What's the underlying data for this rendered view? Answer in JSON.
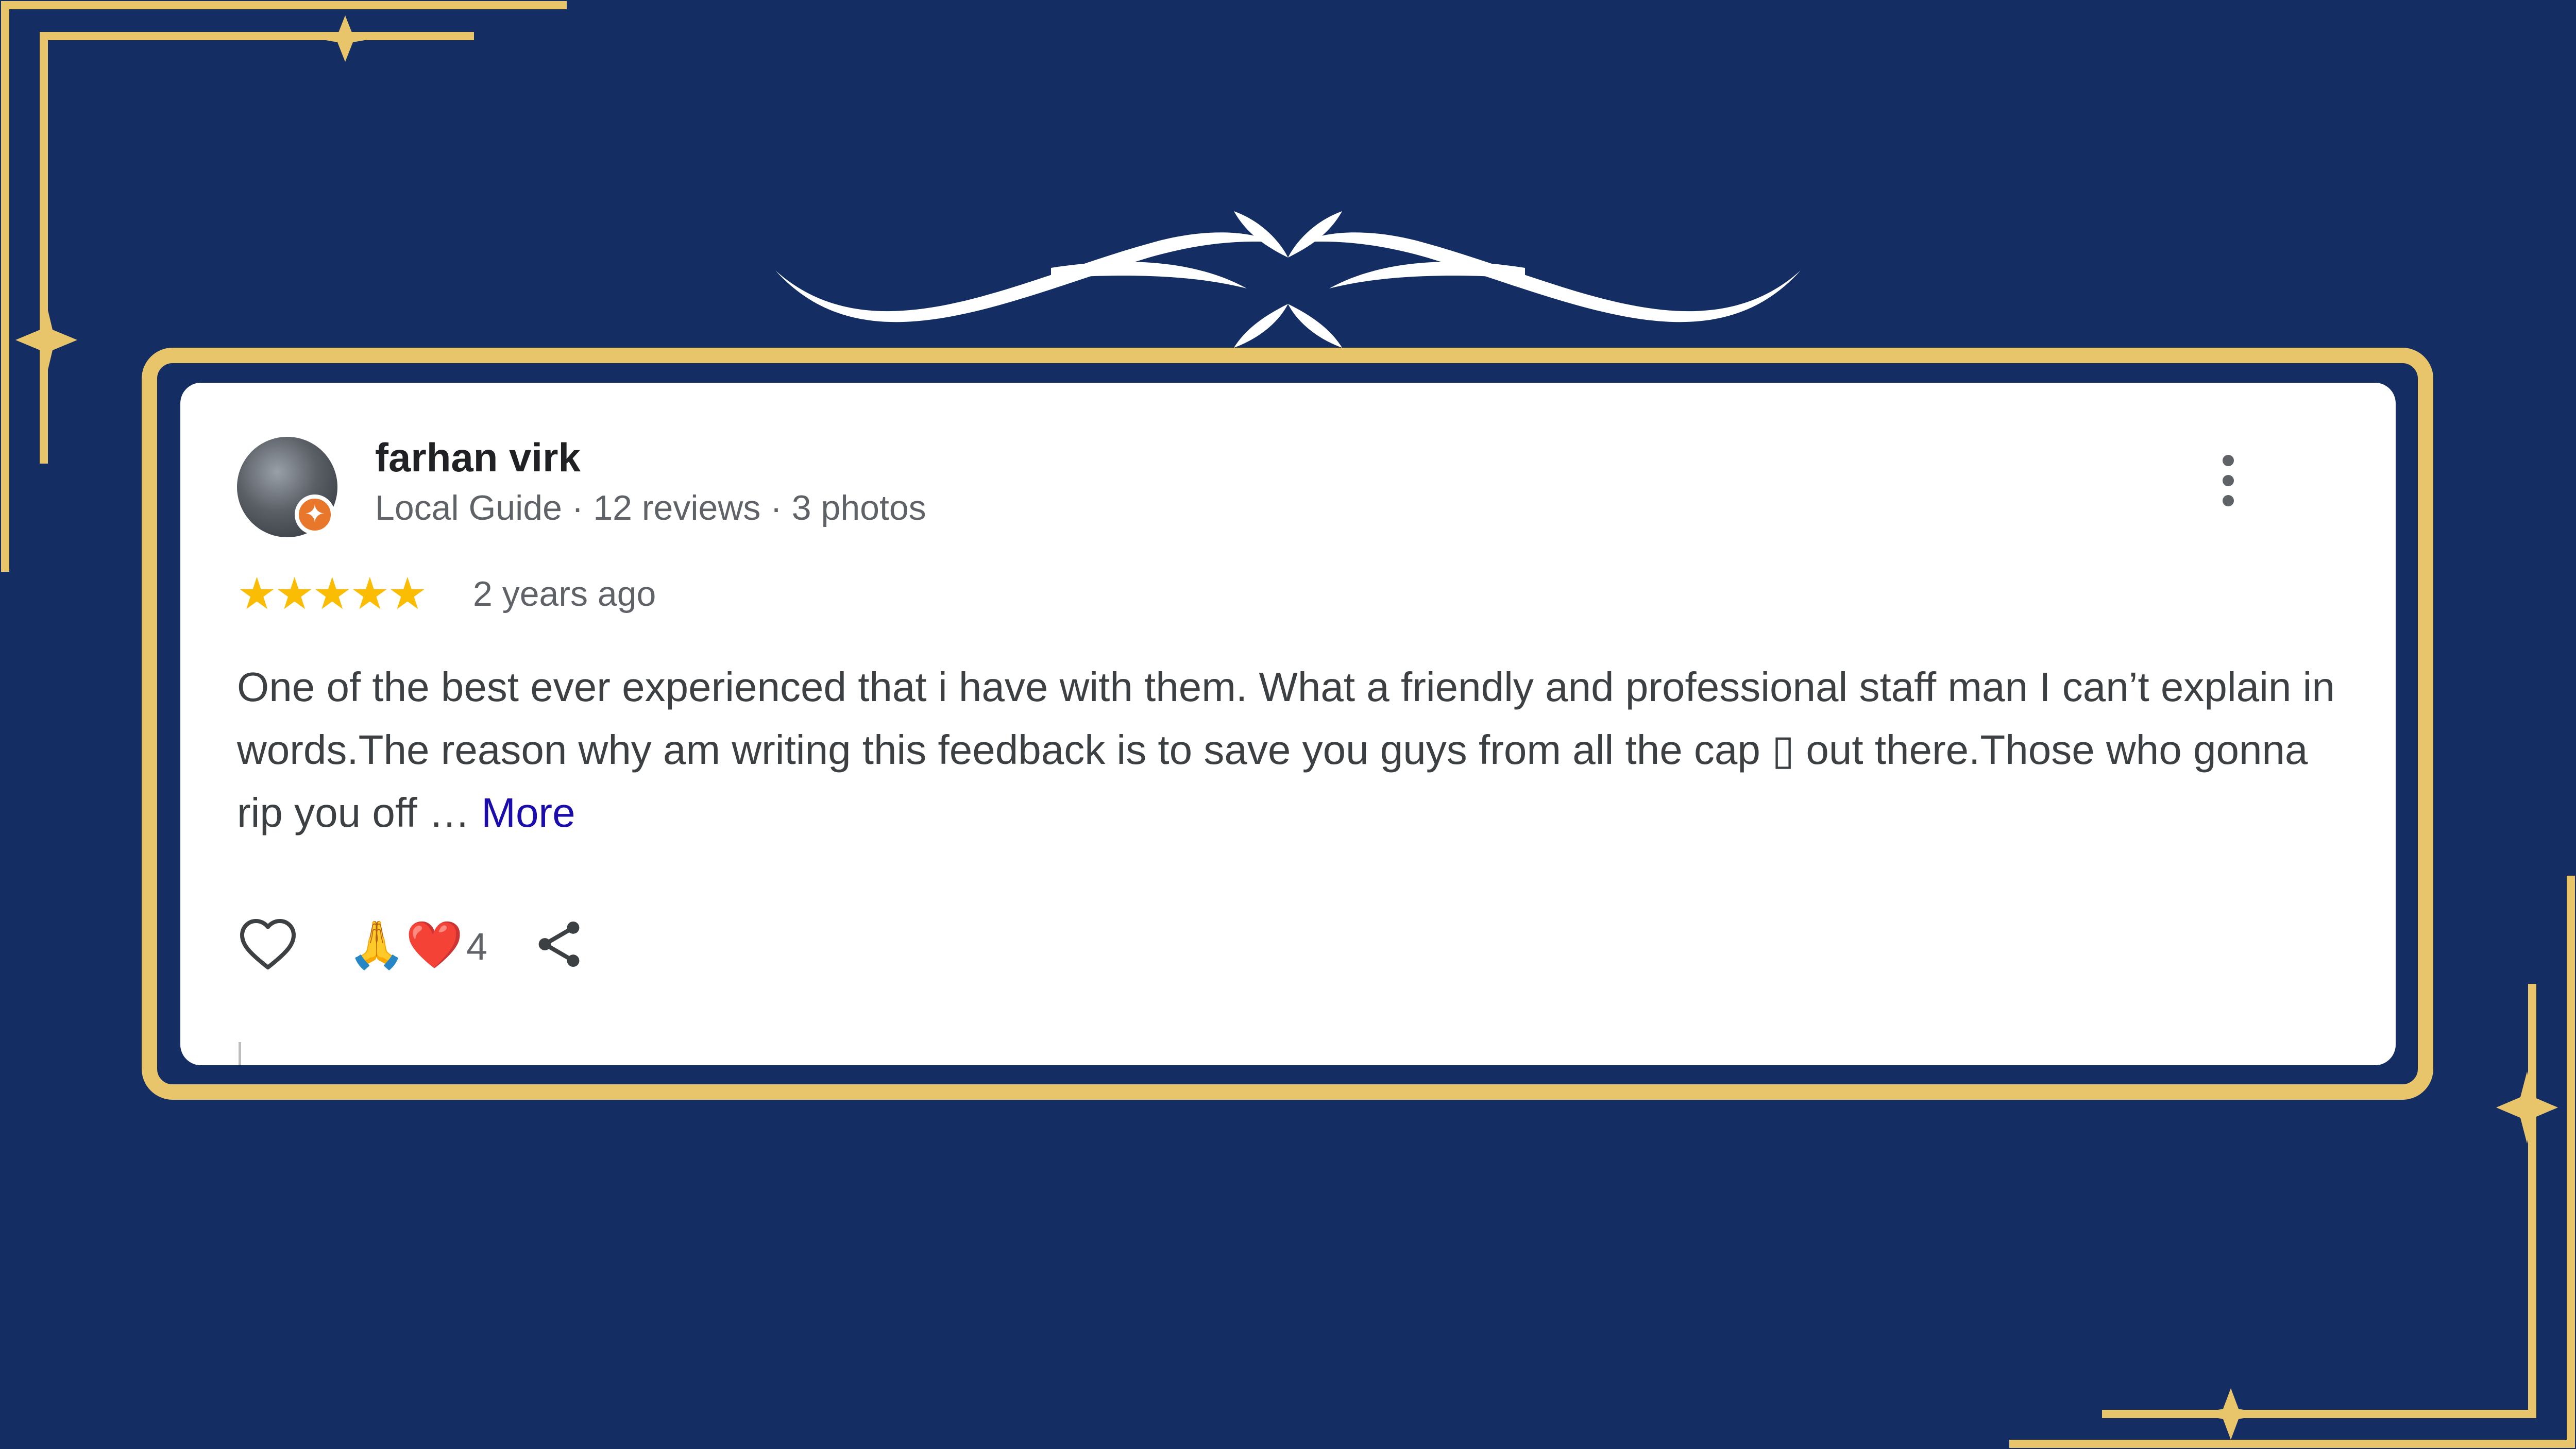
{
  "theme": {
    "background": "#142d63",
    "gold": "#e8c56a",
    "card": "#ffffff",
    "star_color": "#fbbc04",
    "link_color": "#1a0dab"
  },
  "review": {
    "reviewer_name": "farhan virk",
    "reviewer_meta": "Local Guide · 12 reviews · 3 photos",
    "rating": 5,
    "rating_stars": "★★★★★",
    "time_ago": "2 years ago",
    "text": "One of the best ever experienced that i have with them. What a friendly and professional staff man I can’t explain in words.The reason why am writing this feedback is to save you guys from all the cap ▯ out there.Those who gonna rip you off … ",
    "more_label": "More",
    "reactions_emoji": "🙏❤️",
    "reaction_count": "4"
  },
  "icons": {
    "avatar": "profile-photo",
    "badge": "local-guide-badge",
    "menu": "more-vert-icon",
    "like": "heart-outline-icon",
    "share": "share-icon"
  }
}
